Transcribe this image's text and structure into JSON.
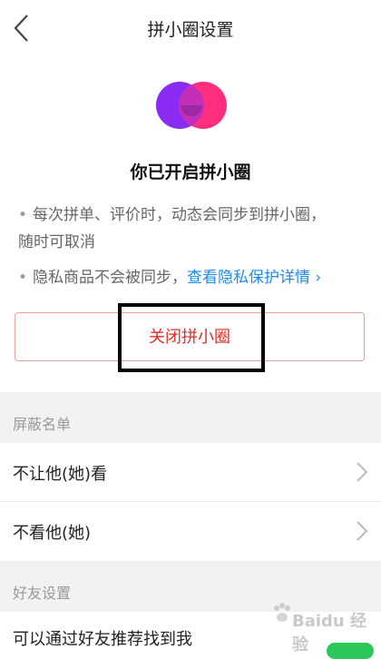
{
  "header": {
    "title": "拼小圈设置",
    "back_icon": "chevron-left-icon"
  },
  "logo": {
    "name": "pinxiaoquan-logo",
    "left_color": "#8b2cf5",
    "right_color": "#ff2e7e"
  },
  "status": {
    "heading": "你已开启拼小圈"
  },
  "bullets": {
    "b1_line1": "每次拼单、评价时，动态会同步到拼小圈，",
    "b1_line2": "随时可取消",
    "b2_text": "隐私商品不会被同步，",
    "b2_link": "查看隐私保护详情 ›"
  },
  "close_button": {
    "label": "关闭拼小圈",
    "color": "#e02e24"
  },
  "blocklist": {
    "section_label": "屏蔽名单",
    "items": [
      {
        "label": "不让他(她)看"
      },
      {
        "label": "不看他(她)"
      }
    ]
  },
  "friends": {
    "section_label": "好友设置",
    "item_label": "可以通过好友推荐找到我",
    "toggle_on": true,
    "toggle_color": "#2dc65b"
  },
  "watermark": {
    "text": "Baidu 经验"
  }
}
